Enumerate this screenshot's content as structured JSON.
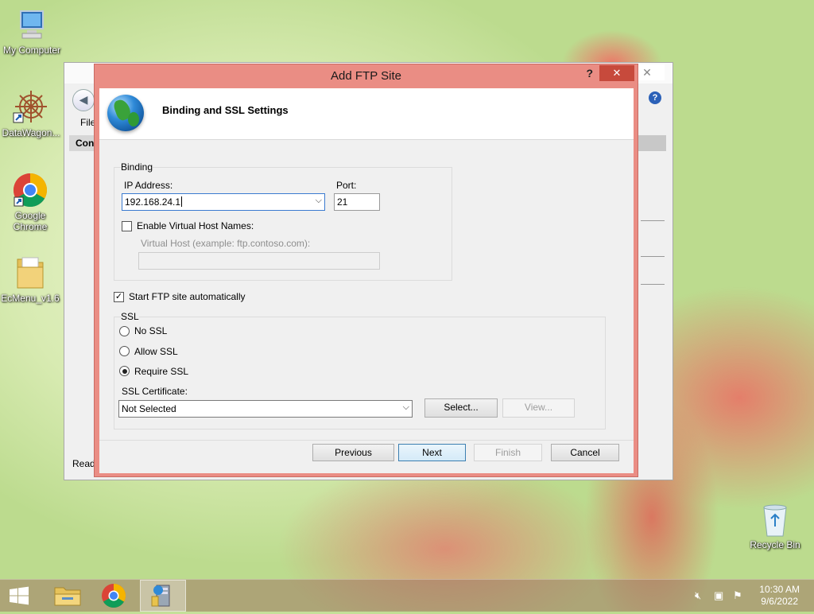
{
  "desktop": {
    "icons": [
      {
        "label": "My Computer"
      },
      {
        "label": "DataWagon..."
      },
      {
        "label": "Google Chrome"
      },
      {
        "label": "EcMenu_v1.6"
      },
      {
        "label": "Recycle Bin"
      }
    ]
  },
  "background_window": {
    "file_menu": "File",
    "connections_header": "Conn",
    "status": "Read"
  },
  "dialog": {
    "title": "Add FTP Site",
    "help_glyph": "?",
    "close_glyph": "✕",
    "page_title": "Binding and SSL Settings",
    "binding": {
      "group_label": "Binding",
      "ip_label": "IP Address:",
      "ip_value": "192.168.24.1",
      "port_label": "Port:",
      "port_value": "21",
      "virtual_host_check_label": "Enable Virtual Host Names:",
      "virtual_host_checked": false,
      "virtual_host_label": "Virtual Host (example: ftp.contoso.com):",
      "virtual_host_value": ""
    },
    "start_automatically_label": "Start FTP site automatically",
    "start_automatically_checked": true,
    "ssl": {
      "group_label": "SSL",
      "options": [
        "No SSL",
        "Allow SSL",
        "Require SSL"
      ],
      "selected": "Require SSL",
      "certificate_label": "SSL Certificate:",
      "certificate_value": "Not Selected",
      "select_button": "Select...",
      "view_button": "View..."
    },
    "buttons": {
      "previous": "Previous",
      "next": "Next",
      "finish": "Finish",
      "cancel": "Cancel"
    }
  },
  "taskbar": {
    "clock_time": "10:30 AM",
    "clock_date": "9/6/2022"
  }
}
